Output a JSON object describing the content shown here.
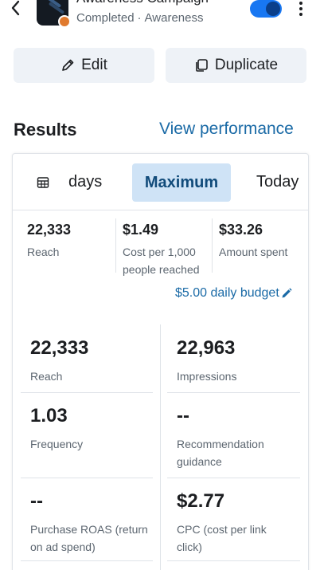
{
  "header": {
    "campaign_title": "Awareness Campaign",
    "status": "Completed",
    "separator": "·",
    "objective": "Awareness",
    "toggle_on": true
  },
  "actions": {
    "edit_label": "Edit",
    "duplicate_label": "Duplicate"
  },
  "results": {
    "title": "Results",
    "view_performance": "View performance"
  },
  "tabs": {
    "days_label": "days",
    "maximum_label": "Maximum",
    "today_label": "Today",
    "selected": "Maximum"
  },
  "summary": [
    {
      "value": "22,333",
      "label": "Reach"
    },
    {
      "value": "$1.49",
      "label": "Cost per 1,000 people reached"
    },
    {
      "value": "$33.26",
      "label": "Amount spent"
    }
  ],
  "budget": "$5.00 daily budget",
  "metrics": [
    {
      "value": "22,333",
      "label": "Reach"
    },
    {
      "value": "22,963",
      "label": "Impressions"
    },
    {
      "value": "1.03",
      "label": "Frequency"
    },
    {
      "value": "--",
      "label": "Recommendation guidance"
    },
    {
      "value": "--",
      "label": "Purchase ROAS (return on ad spend)"
    },
    {
      "value": "$2.77",
      "label": "CPC (cost per link click)"
    }
  ],
  "colors": {
    "accent": "#1877f2",
    "link": "#1a6aa6",
    "selected_tab_bg": "#cfe3f6",
    "button_bg": "#eef2f7"
  }
}
